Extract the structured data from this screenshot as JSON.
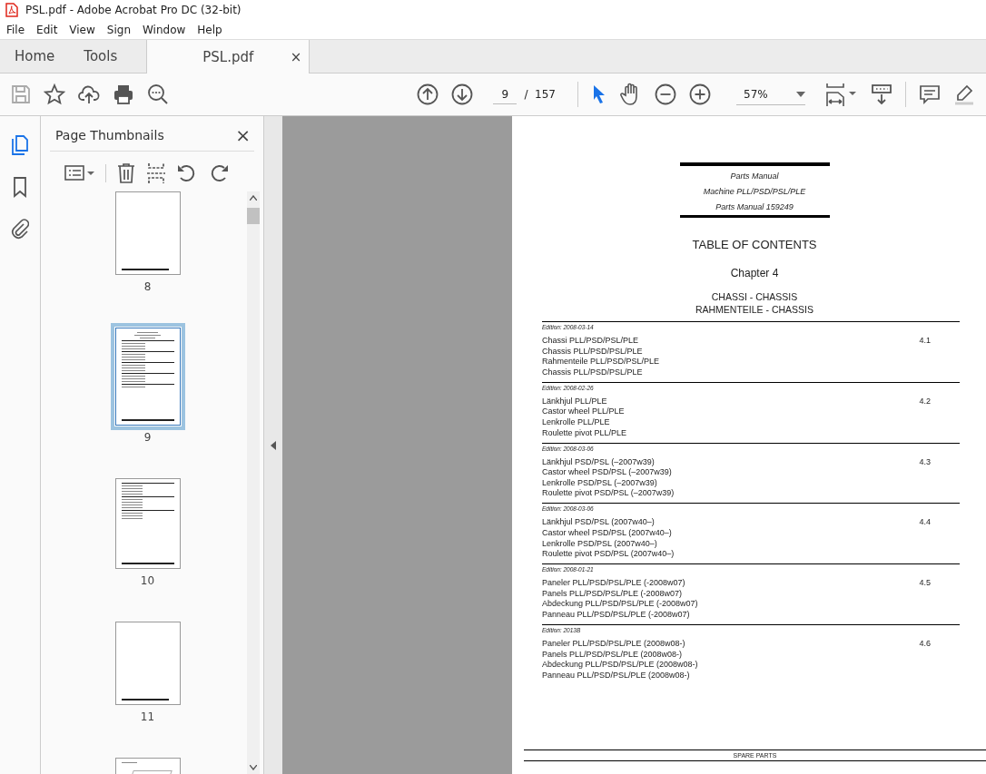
{
  "window": {
    "title": "PSL.pdf - Adobe Acrobat Pro DC (32-bit)"
  },
  "menu": [
    "File",
    "Edit",
    "View",
    "Sign",
    "Window",
    "Help"
  ],
  "tabs": [
    {
      "label": "Home",
      "selected": false
    },
    {
      "label": "Tools",
      "selected": false
    },
    {
      "label": "PSL.pdf",
      "selected": true,
      "close": "×"
    }
  ],
  "toolbar": {
    "page_number": "9",
    "page_total": "/  157",
    "zoom": "57%"
  },
  "panel": {
    "title": "Page Thumbnails",
    "close": "×",
    "thumbnails": [
      {
        "label": "8",
        "kind": "blank",
        "selected": false
      },
      {
        "label": "9",
        "kind": "toc",
        "selected": true
      },
      {
        "label": "10",
        "kind": "list",
        "selected": false
      },
      {
        "label": "11",
        "kind": "blank",
        "selected": false
      },
      {
        "kind": "drawing",
        "selected": false
      }
    ]
  },
  "document": {
    "header": [
      "Parts Manual",
      "Machine PLL/PSD/PSL/PLE",
      "Parts Manual 159249"
    ],
    "title": "TABLE OF CONTENTS",
    "chapter": "Chapter 4",
    "subtitle": [
      "CHASSI - CHASSIS",
      "RAHMENTEILE - CHASSIS"
    ],
    "sections": [
      {
        "edition": "Edition: 2008-03-14",
        "number": "4.1",
        "lines": [
          "Chassi PLL/PSD/PSL/PLE",
          "Chassis PLL/PSD/PSL/PLE",
          "Rahmenteile PLL/PSD/PSL/PLE",
          "Chassis PLL/PSD/PSL/PLE"
        ]
      },
      {
        "edition": "Edition: 2008-02-26",
        "number": "4.2",
        "lines": [
          "Länkhjul PLL/PLE",
          "Castor wheel PLL/PLE",
          "Lenkrolle PLL/PLE",
          "Roulette pivot PLL/PLE"
        ]
      },
      {
        "edition": "Edition: 2008-03-06",
        "number": "4.3",
        "lines": [
          "Länkhjul PSD/PSL (–2007w39)",
          "Castor wheel PSD/PSL (–2007w39)",
          "Lenkrolle PSD/PSL (–2007w39)",
          "Roulette pivot PSD/PSL (–2007w39)"
        ]
      },
      {
        "edition": "Edition: 2008-03-06",
        "number": "4.4",
        "lines": [
          "Länkhjul PSD/PSL (2007w40–)",
          "Castor wheel PSD/PSL (2007w40–)",
          "Lenkrolle PSD/PSL (2007w40–)",
          "Roulette pivot PSD/PSL (2007w40–)"
        ]
      },
      {
        "edition": "Edition: 2008-01-21",
        "number": "4.5",
        "lines": [
          "Paneler PLL/PSD/PSL/PLE (-2008w07)",
          "Panels PLL/PSD/PSL/PLE (-2008w07)",
          "Abdeckung PLL/PSD/PSL/PLE (-2008w07)",
          "Panneau PLL/PSD/PSL/PLE (-2008w07)"
        ]
      },
      {
        "edition": "Edition: 2013B",
        "number": "4.6",
        "lines": [
          "Paneler PLL/PSD/PSL/PLE (2008w08-)",
          "Panels PLL/PSD/PSL/PLE (2008w08-)",
          "Abdeckung PLL/PSD/PSL/PLE (2008w08-)",
          "Panneau PLL/PSD/PSL/PLE (2008w08-)"
        ]
      }
    ],
    "footer": "SPARE PARTS"
  }
}
